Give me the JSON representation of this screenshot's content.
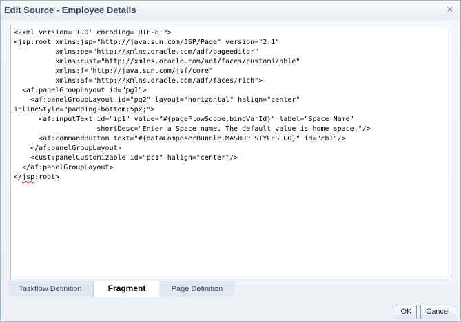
{
  "dialog": {
    "title": "Edit Source - Employee Details",
    "close_icon": "close-icon"
  },
  "editor": {
    "lines": [
      "<?xml version='1.0' encoding='UTF-8'?>",
      "<jsp:root xmlns:jsp=\"http://java.sun.com/JSP/Page\" version=\"2.1\"",
      "          xmlns:pe=\"http://xmlns.oracle.com/adf/pageeditor\"",
      "          xmlns:cust=\"http://xmlns.oracle.com/adf/faces/customizable\"",
      "          xmlns:f=\"http://java.sun.com/jsf/core\"",
      "          xmlns:af=\"http://xmlns.oracle.com/adf/faces/rich\">",
      "  <af:panelGroupLayout id=\"pg1\">",
      "    <af:panelGroupLayout id=\"pg2\" layout=\"horizontal\" halign=\"center\"",
      "inlineStyle=\"padding-bottom:5px;\">",
      "      <af:inputText id=\"ip1\" value=\"#{pageFlowScope.bindVarId}\" label=\"Space Name\"",
      "                    shortDesc=\"Enter a Space name. The default value is home space.\"/>",
      "      <af:commandButton text=\"#{dataComposerBundle.MASHUP_STYLES_GO}\" id=\"cb1\"/>",
      "    </af:panelGroupLayout>",
      "    <cust:panelCustomizable id=\"pc1\" halign=\"center\"/>",
      "  </af:panelGroupLayout>"
    ],
    "last_line_prefix": "</",
    "last_line_squiggle": "jsp",
    "last_line_suffix": ":root>"
  },
  "tabs": [
    {
      "label": "Taskflow Definition",
      "active": false
    },
    {
      "label": "Fragment",
      "active": true
    },
    {
      "label": "Page Definition",
      "active": false
    }
  ],
  "buttons": {
    "ok": "OK",
    "cancel": "Cancel"
  }
}
